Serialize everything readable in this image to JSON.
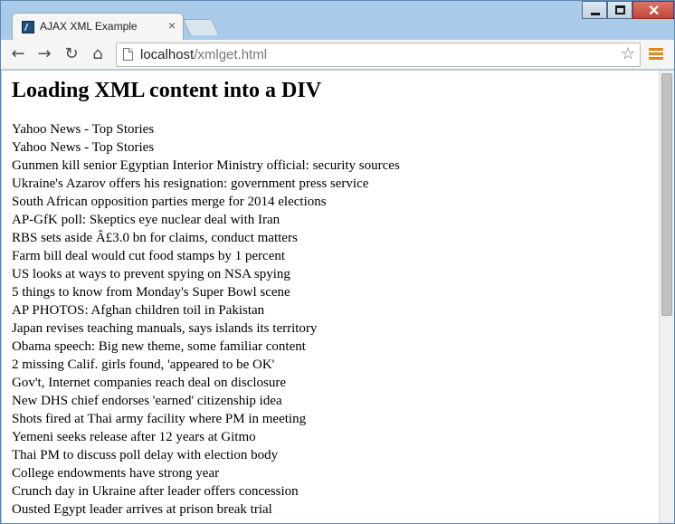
{
  "window": {
    "tab_title": "AJAX XML Example",
    "tab_close": "×",
    "minimize": "",
    "maximize": "",
    "close": "✕"
  },
  "toolbar": {
    "back_icon": "←",
    "forward_icon": "→",
    "reload_icon": "↻",
    "home_icon": "⌂",
    "url_host": "localhost",
    "url_path": "/xmlget.html",
    "star_icon": "☆"
  },
  "page": {
    "heading": "Loading XML content into a DIV",
    "items": [
      "Yahoo News - Top Stories",
      "Yahoo News - Top Stories",
      "Gunmen kill senior Egyptian Interior Ministry official: security sources",
      "Ukraine's Azarov offers his resignation: government press service",
      "South African opposition parties merge for 2014 elections",
      "AP-GfK poll: Skeptics eye nuclear deal with Iran",
      "RBS sets aside Â£3.0 bn for claims, conduct matters",
      "Farm bill deal would cut food stamps by 1 percent",
      "US looks at ways to prevent spying on NSA spying",
      "5 things to know from Monday's Super Bowl scene",
      "AP PHOTOS: Afghan children toil in Pakistan",
      "Japan revises teaching manuals, says islands its territory",
      "Obama speech: Big new theme, some familiar content",
      "2 missing Calif. girls found, 'appeared to be OK'",
      "Gov't, Internet companies reach deal on disclosure",
      "New DHS chief endorses 'earned' citizenship idea",
      "Shots fired at Thai army facility where PM in meeting",
      "Yemeni seeks release after 12 years at Gitmo",
      "Thai PM to discuss poll delay with election body",
      "College endowments have strong year",
      "Crunch day in Ukraine after leader offers concession",
      "Ousted Egypt leader arrives at prison break trial"
    ]
  }
}
